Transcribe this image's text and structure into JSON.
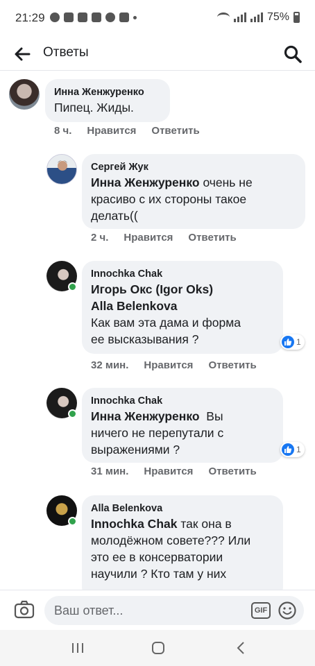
{
  "status_bar": {
    "time": "21:29",
    "battery": "75%"
  },
  "header": {
    "title": "Ответы",
    "back_icon": "arrow-left-icon",
    "search_icon": "search-icon"
  },
  "comments": [
    {
      "author": "Инна Женжуренко",
      "mentions": [],
      "text": "Пипец. Жиды.",
      "time": "8 ч.",
      "like_label": "Нравится",
      "reply_label": "Ответить"
    },
    {
      "author": "Сергей Жук",
      "mentions": [
        "Инна Женжуренко"
      ],
      "text_lines": [
        "очень не",
        "красиво с их стороны такое",
        "делать(("
      ],
      "time": "2 ч.",
      "like_label": "Нравится",
      "reply_label": "Ответить"
    },
    {
      "author": "Innochka Chak",
      "mentions": [
        "Игорь Окс (Igor Oks)",
        "Alla Belenkova"
      ],
      "text_lines": [
        "Как вам эта дама и форма",
        "ее высказывания ?"
      ],
      "time": "32 мин.",
      "like_label": "Нравится",
      "reply_label": "Ответить",
      "reaction_count": "1"
    },
    {
      "author": "Innochka Chak",
      "mentions": [
        "Инна Женжуренко"
      ],
      "text_lines": [
        "Вы",
        "ничего не перепутали с",
        "выражениями ?"
      ],
      "time": "31 мин.",
      "like_label": "Нравится",
      "reply_label": "Ответить",
      "reaction_count": "1"
    },
    {
      "author": "Alla Belenkova",
      "mentions": [
        "Innochka Chak"
      ],
      "text_lines": [
        "так она в",
        "молодёжном совете??? Или",
        "это ее в консерватории",
        "научили ? Кто там у них"
      ]
    }
  ],
  "composer": {
    "placeholder": "Ваш ответ...",
    "gif_label": "GIF"
  },
  "colors": {
    "bubble": "#f0f2f5",
    "like_blue": "#1877f2",
    "online_green": "#31a24c",
    "meta_gray": "#65676b"
  }
}
